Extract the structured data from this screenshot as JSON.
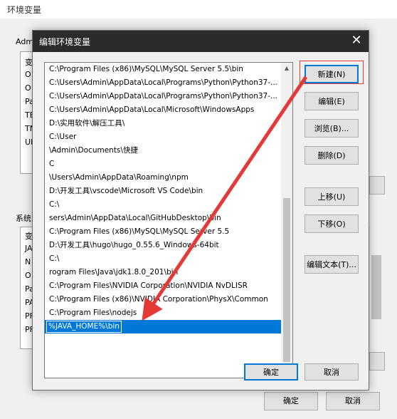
{
  "background_window": {
    "title": "环境变量",
    "user_group_label": "Adm",
    "user_list_cut": [
      "变",
      "O",
      "O",
      "Pa",
      "TE",
      "TM",
      "UI"
    ],
    "system_group_label": "系统",
    "system_list_cut": [
      "变",
      "JA",
      "N",
      "O",
      "Pa",
      "PA",
      "PF",
      "PF"
    ],
    "ok_label": "确定",
    "cancel_label": "取消"
  },
  "dialog": {
    "title": "编辑环境变量",
    "close_glyph": "✕",
    "entries": [
      "C:\\Program Files (x86)\\MySQL\\MySQL Server 5.5\\bin",
      "C:\\Users\\Admin\\AppData\\Local\\Programs\\Python\\Python37-...",
      "C:\\Users\\Admin\\AppData\\Local\\Programs\\Python\\Python37-...",
      "C:\\Users\\Admin\\AppData\\Local\\Microsoft\\WindowsApps",
      "D:\\实用软件\\解压工具\\",
      "C:\\User",
      "\\Admin\\Documents\\快捷",
      "C",
      "\\Users\\Admin\\AppData\\Roaming\\npm",
      "D:\\开发工具\\vscode\\Microsoft VS Code\\bin",
      "C:\\",
      "sers\\Admin\\AppData\\Local\\GitHubDesktop\\bin",
      "C:\\Program Files (x86)\\MySQL\\MySQL Server 5.5",
      "D:\\开发工具\\hugo\\hugo_0.55.6_Windows-64bit",
      "C:\\",
      "rogram Files\\Java\\jdk1.8.0_201\\bin",
      "C:\\Program Files\\NVIDIA Corporation\\NVIDIA NvDLISR",
      "C:\\Program Files (x86)\\NVIDIA Corporation\\PhysX\\Common",
      "C:\\Program Files\\nodejs"
    ],
    "selected_entry": "%JAVA_HOME%\\bin",
    "buttons": {
      "new": "新建(N)",
      "edit": "编辑(E)",
      "browse": "浏览(B)...",
      "delete": "删除(D)",
      "move_up": "上移(U)",
      "move_down": "下移(O)",
      "edit_text": "编辑文本(T)..."
    },
    "ok_label": "确定",
    "cancel_label": "取消"
  },
  "colors": {
    "selection": "#0078d7",
    "annotation": "#e53935",
    "titlebar": "#2b2b2b"
  }
}
